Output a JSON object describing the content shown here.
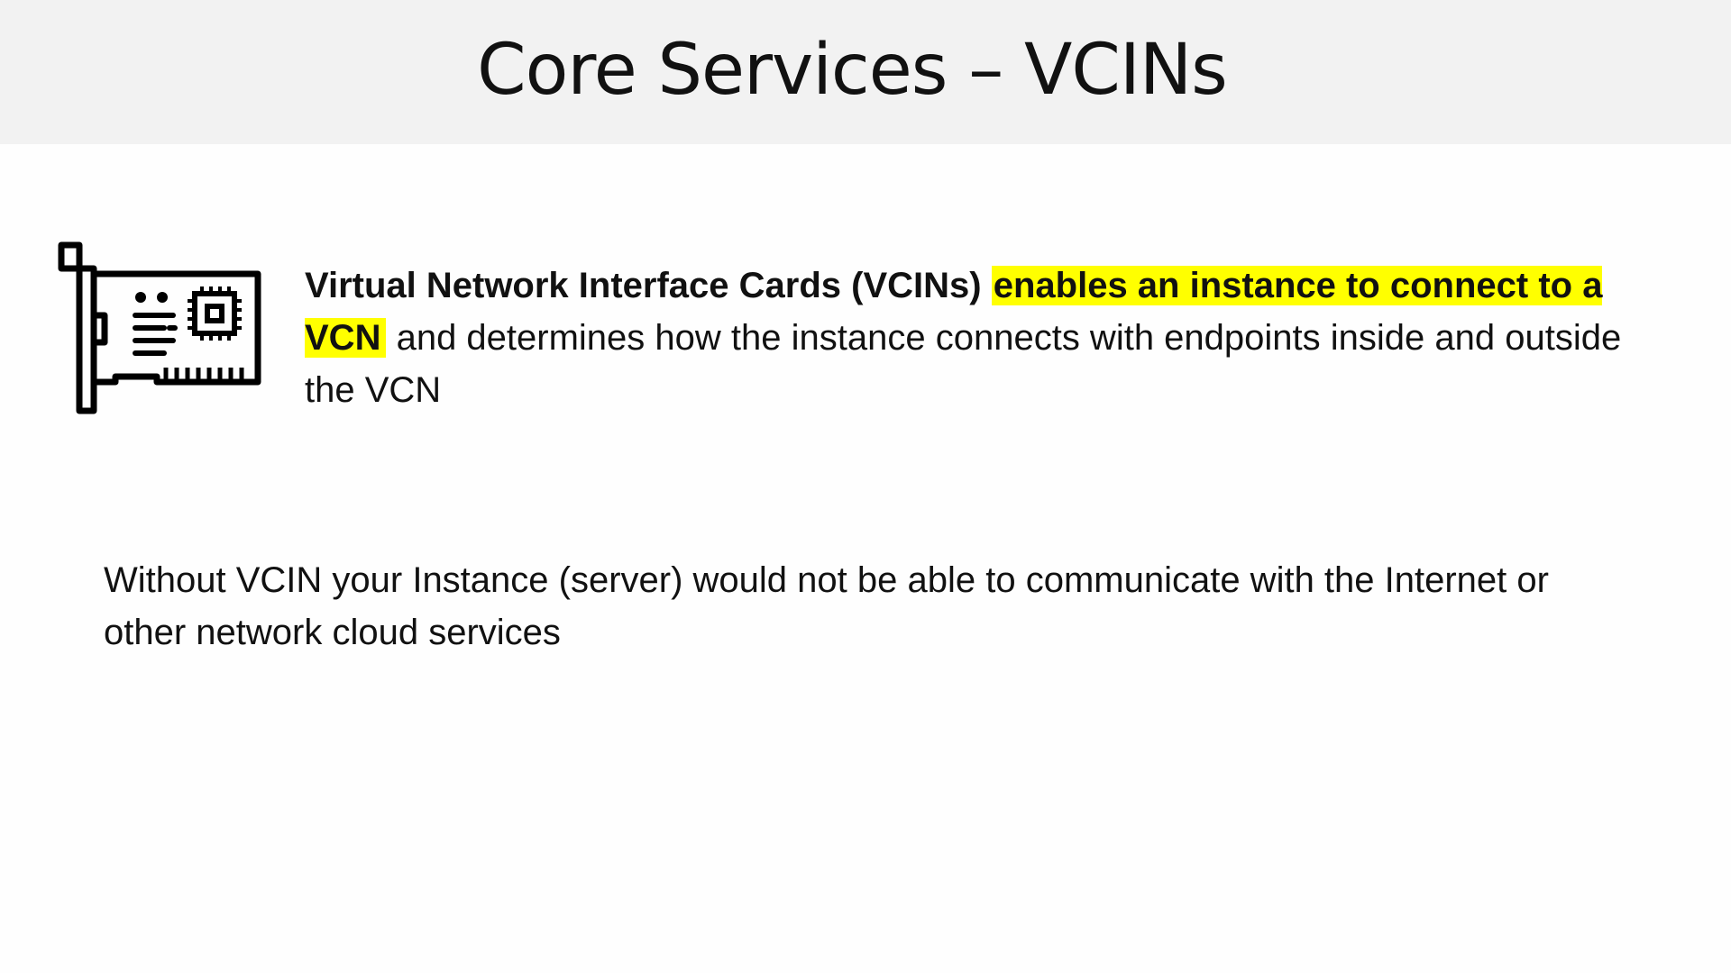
{
  "slide": {
    "title": "Core Services –  VCINs",
    "icon": "network-card-icon",
    "paragraph1": {
      "bold_text": "Virtual Network Interface Cards (VCINs)",
      "highlighted_text": "enables an instance to connect to a VCN",
      "rest_text": "and determines how the instance connects with endpoints inside and outside the VCN",
      "highlight_color": "#ffff00"
    },
    "paragraph2": "Without VCIN your Instance (server) would not be able to communicate with the Internet or other network cloud services"
  }
}
